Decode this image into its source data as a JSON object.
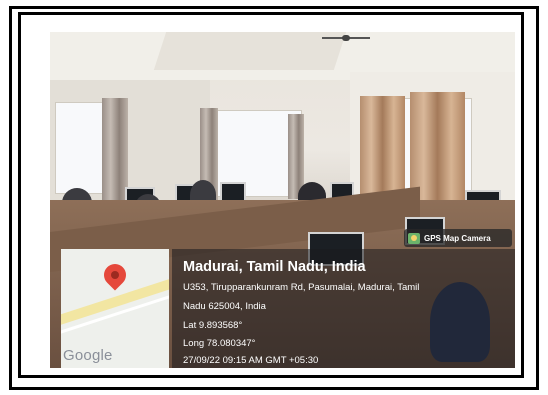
{
  "overlay": {
    "app_tag": "GPS Map Camera",
    "map_logo": "Google",
    "location_title": "Madurai, Tamil Nadu, India",
    "address_line1": "U353, Tirupparankunram Rd, Pasumalai, Madurai, Tamil",
    "address_line2": "Nadu 625004, India",
    "latitude": "Lat 9.893568°",
    "longitude": "Long 78.080347°",
    "timestamp": "27/09/22 09:15 AM GMT +05:30"
  },
  "colors": {
    "frame": "#000000",
    "pin": "#e5483b",
    "overlay_bg": "#19191e"
  },
  "icons": [
    "camera-icon",
    "map-pin-icon"
  ]
}
